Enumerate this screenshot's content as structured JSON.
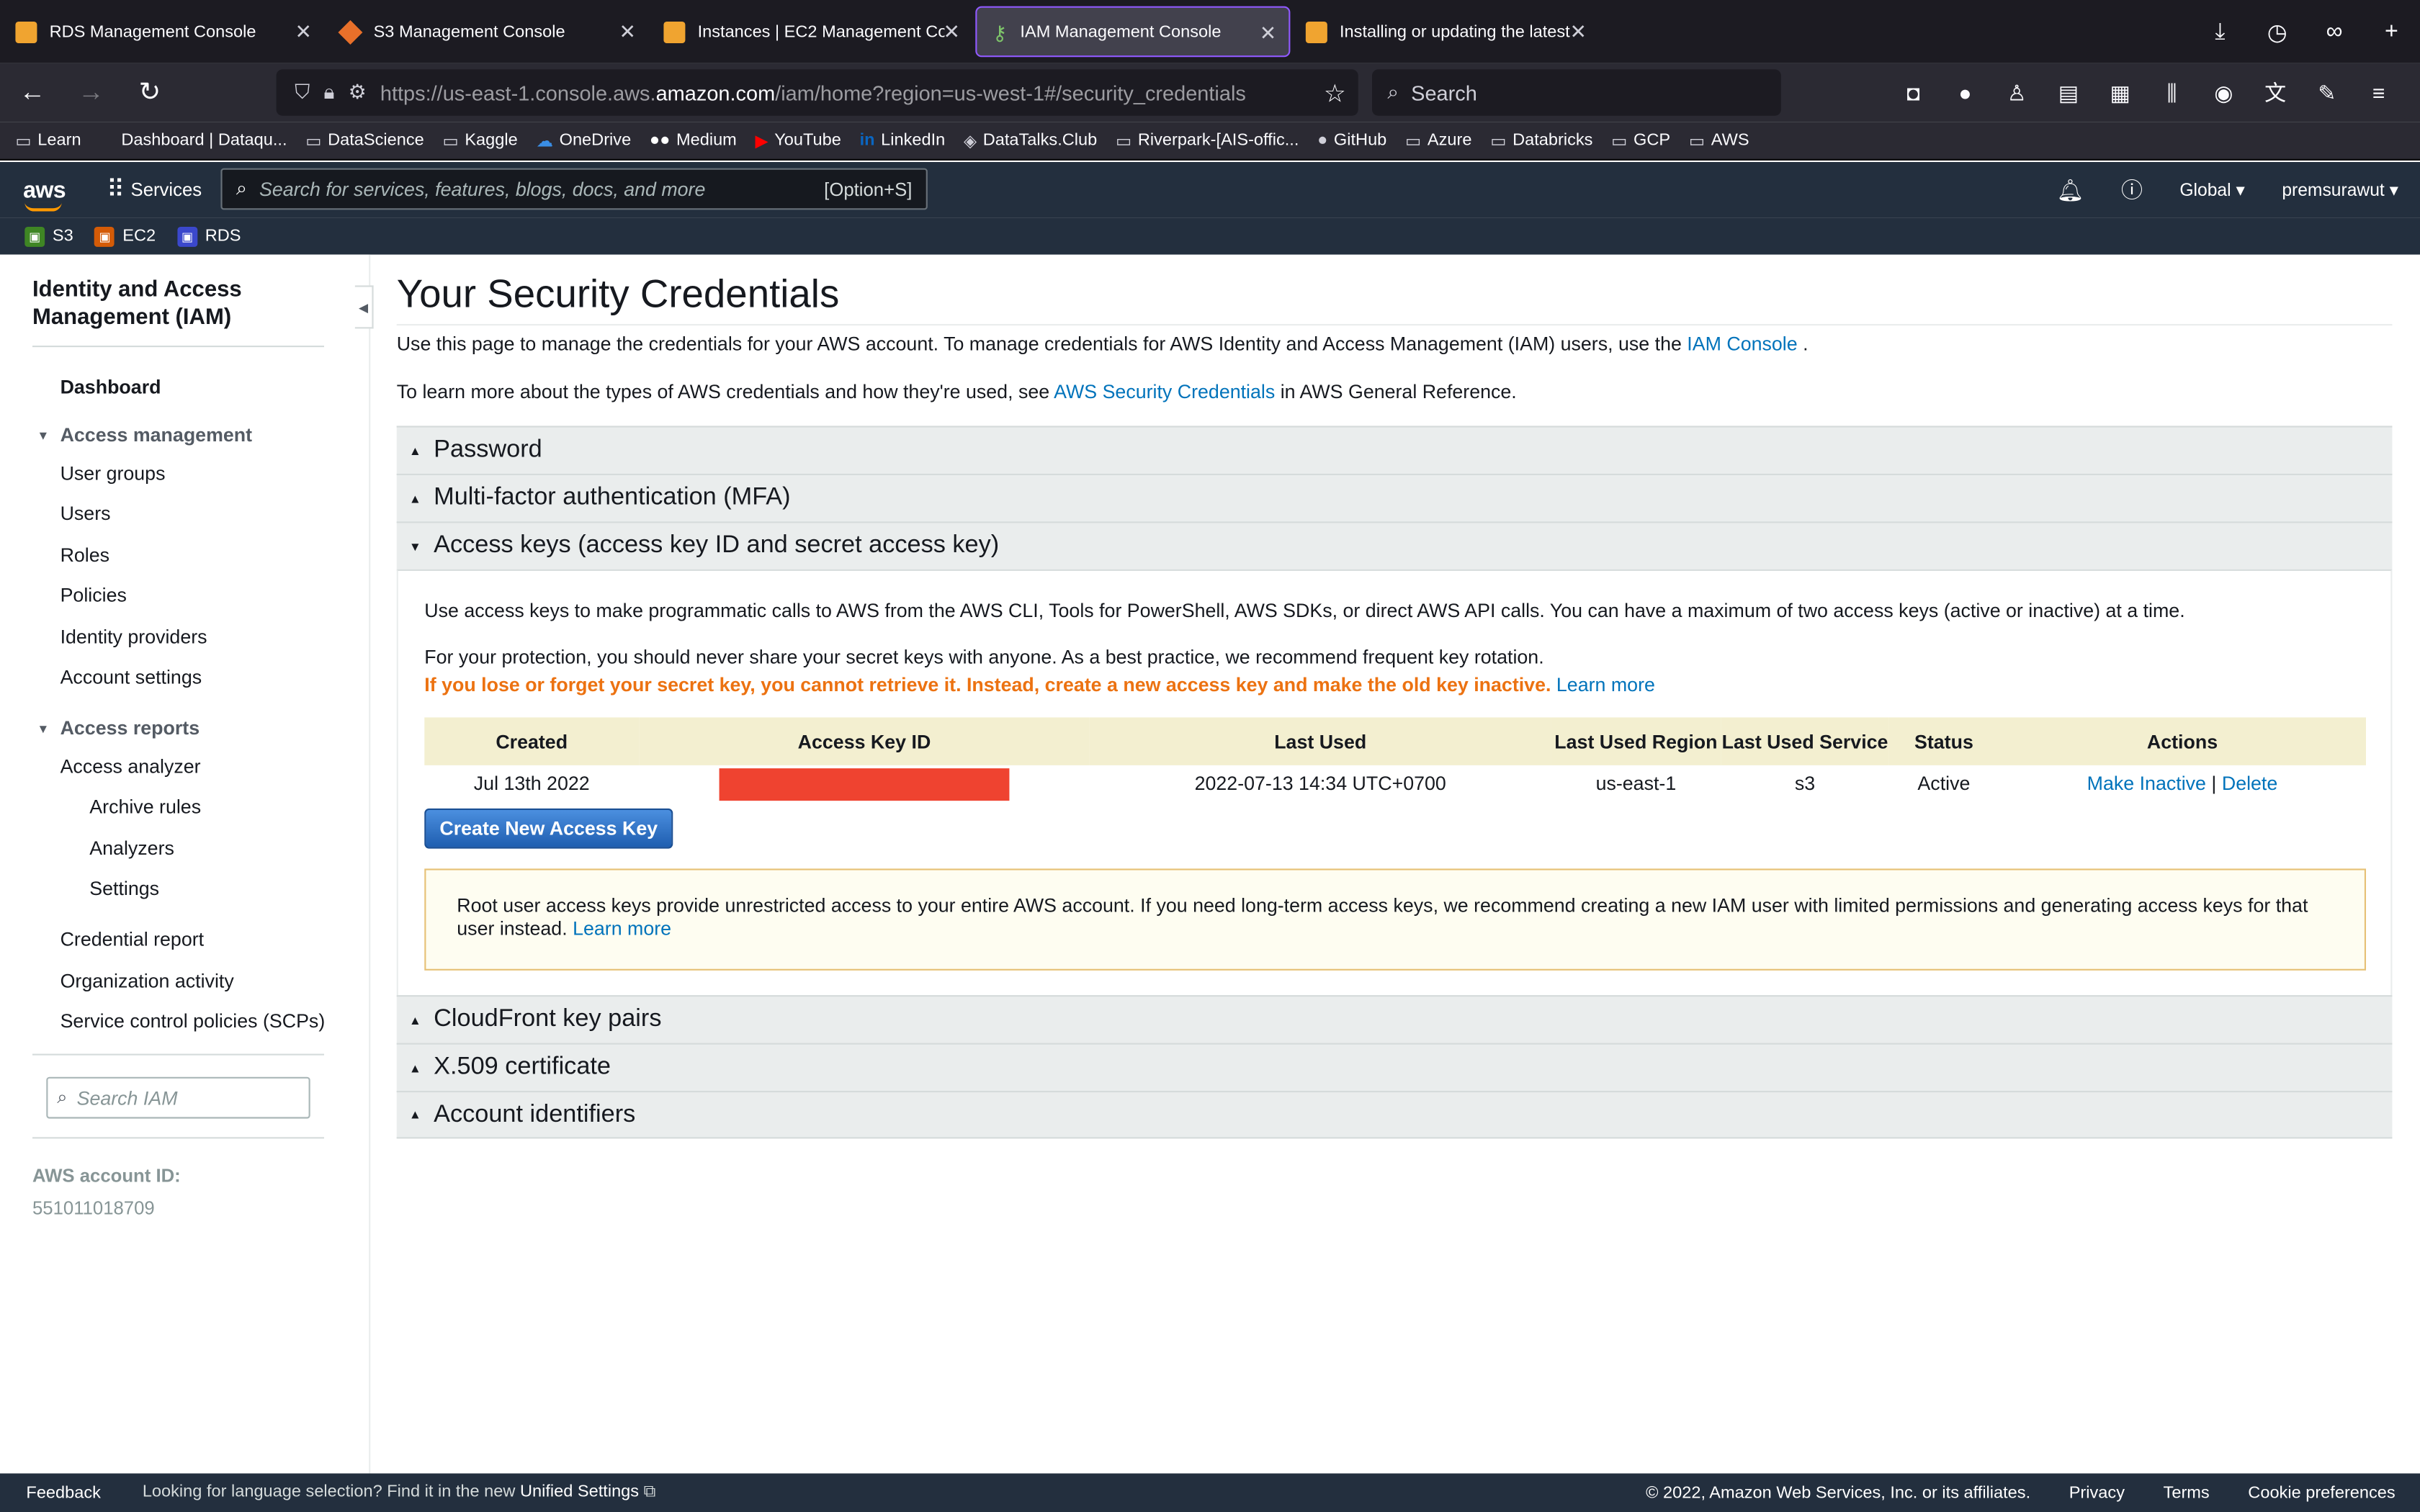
{
  "browser": {
    "tabs": [
      {
        "title": "RDS Management Console",
        "active": false
      },
      {
        "title": "S3 Management Console",
        "active": false
      },
      {
        "title": "Instances | EC2 Management Co",
        "active": false
      },
      {
        "title": "IAM Management Console",
        "active": true
      },
      {
        "title": "Installing or updating the latest",
        "active": false
      }
    ],
    "url_prefix": "https://us-east-1.console.aws.",
    "url_host": "amazon.com",
    "url_path": "/iam/home?region=us-west-1#/security_credentials",
    "search_placeholder": "Search",
    "bookmarks": [
      "Learn",
      "Dashboard | Dataqu...",
      "DataScience",
      "Kaggle",
      "OneDrive",
      "Medium",
      "YouTube",
      "LinkedIn",
      "DataTalks.Club",
      "Riverpark-[AIS-offic...",
      "GitHub",
      "Azure",
      "Databricks",
      "GCP",
      "AWS"
    ]
  },
  "aws_header": {
    "logo": "aws",
    "services_label": "Services",
    "search_placeholder": "Search for services, features, blogs, docs, and more",
    "search_shortcut": "[Option+S]",
    "region": "Global",
    "account": "premsurawut",
    "favorites": [
      "S3",
      "EC2",
      "RDS"
    ]
  },
  "sidebar": {
    "title": "Identity and Access Management (IAM)",
    "dashboard": "Dashboard",
    "access_management": "Access management",
    "am_items": [
      "User groups",
      "Users",
      "Roles",
      "Policies",
      "Identity providers",
      "Account settings"
    ],
    "access_reports": "Access reports",
    "access_analyzer": "Access analyzer",
    "analyzer_items": [
      "Archive rules",
      "Analyzers",
      "Settings"
    ],
    "report_items": [
      "Credential report",
      "Organization activity",
      "Service control policies (SCPs)"
    ],
    "search_placeholder": "Search IAM",
    "account_id_label": "AWS account ID:",
    "account_id": "551011018709"
  },
  "main": {
    "title": "Your Security Credentials",
    "intro1": "Use this page to manage the credentials for your AWS account. To manage credentials for AWS Identity and Access Management (IAM) users, use the ",
    "intro1_link": "IAM Console",
    "intro1_end": " .",
    "intro2": "To learn more about the types of AWS credentials and how they're used, see ",
    "intro2_link": "AWS Security Credentials",
    "intro2_end": " in AWS General Reference.",
    "sections": {
      "password": "Password",
      "mfa": "Multi-factor authentication (MFA)",
      "access_keys": "Access keys (access key ID and secret access key)",
      "cloudfront": "CloudFront key pairs",
      "x509": "X.509 certificate",
      "account_ids": "Account identifiers"
    },
    "ak_desc": "Use access keys to make programmatic calls to AWS from the AWS CLI, Tools for PowerShell, AWS SDKs, or direct AWS API calls. You can have a maximum of two access keys (active or inactive) at a time.",
    "ak_protect": "For your protection, you should never share your secret keys with anyone. As a best practice, we recommend frequent key rotation.",
    "ak_warning": "If you lose or forget your secret key, you cannot retrieve it. Instead, create a new access key and make the old key inactive.",
    "learn_more": "Learn more",
    "table": {
      "headers": {
        "created": "Created",
        "access_key_id": "Access Key ID",
        "last_used": "Last Used",
        "last_used_region": "Last Used Region",
        "last_used_service": "Last Used Service",
        "status": "Status",
        "actions": "Actions"
      },
      "row": {
        "created": "Jul 13th 2022",
        "last_used": "2022-07-13 14:34 UTC+0700",
        "region": "us-east-1",
        "service": "s3",
        "status": "Active",
        "make_inactive": "Make Inactive",
        "separator": "|",
        "delete": "Delete"
      }
    },
    "create_button": "Create New Access Key",
    "root_alert": "Root user access keys provide unrestricted access to your entire AWS account. If you need long-term access keys, we recommend creating a new IAM user with limited permissions and generating access keys for that user instead. ",
    "root_alert_link": "Learn more"
  },
  "footer": {
    "feedback": "Feedback",
    "lang_text": "Looking for language selection? Find it in the new ",
    "lang_link": "Unified Settings",
    "copyright": "© 2022, Amazon Web Services, Inc. or its affiliates.",
    "links": [
      "Privacy",
      "Terms",
      "Cookie preferences"
    ]
  }
}
